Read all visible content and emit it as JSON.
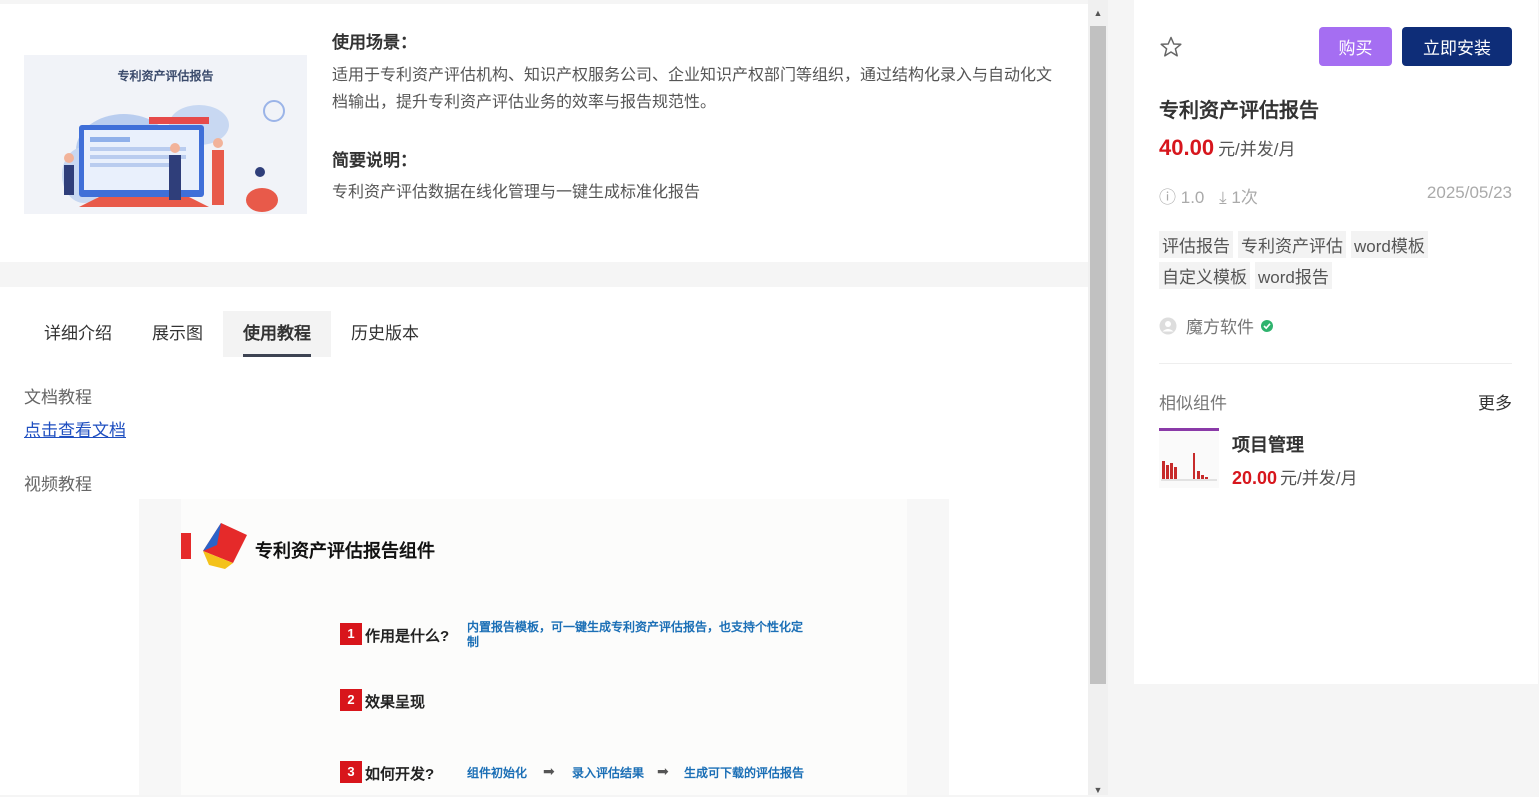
{
  "thumbnail": {
    "title": "专利资产评估报告"
  },
  "usage": {
    "title": "使用场景：",
    "text": "适用于专利资产评估机构、知识产权服务公司、企业知识产权部门等组织，通过结构化录入与自动化文档输出，提升专利资产评估业务的效率与报告规范性。"
  },
  "summary": {
    "title": "简要说明：",
    "text": "专利资产评估数据在线化管理与一键生成标准化报告"
  },
  "tabs": [
    {
      "label": "详细介绍",
      "active": false
    },
    {
      "label": "展示图",
      "active": false
    },
    {
      "label": "使用教程",
      "active": true
    },
    {
      "label": "历史版本",
      "active": false
    }
  ],
  "tutorial": {
    "doc_label": "文档教程",
    "doc_link": "点击查看文档",
    "video_label": "视频教程"
  },
  "slide": {
    "title": "专利资产评估报告组件",
    "steps": [
      {
        "num": "1",
        "label": "作用是什么?",
        "desc": "内置报告模板，可一键生成专利资产评估报告，也支持个性化定制"
      },
      {
        "num": "2",
        "label": "效果呈现",
        "desc": ""
      },
      {
        "num": "3",
        "label": "如何开发?",
        "flow": [
          "组件初始化",
          "录入评估结果",
          "生成可下载的评估报告"
        ]
      }
    ]
  },
  "product": {
    "buy_label": "购买",
    "install_label": "立即安装",
    "title": "专利资产评估报告",
    "price": "40.00",
    "price_unit": "元/并发/月",
    "version": "1.0",
    "downloads": "1次",
    "date": "2025/05/23",
    "tags": [
      "评估报告",
      "专利资产评估",
      "word模板",
      "自定义模板",
      "word报告"
    ],
    "vendor": "魔方软件",
    "colors": {
      "buy": "#a56ef2",
      "install": "#0e2d78",
      "price": "#d7161d"
    }
  },
  "similar": {
    "title": "相似组件",
    "more": "更多",
    "items": [
      {
        "name": "项目管理",
        "price": "20.00",
        "price_unit": "元/并发/月"
      }
    ]
  }
}
